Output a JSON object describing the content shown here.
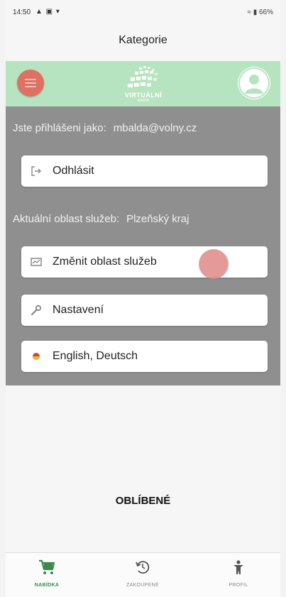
{
  "status_bar": {
    "time": "14:50",
    "icons": "▲ ▣ ▾",
    "right": "≈ ▮ 66%"
  },
  "page": {
    "title": "Kategorie"
  },
  "header": {
    "logo_text": "VIRTUÁLNÍ",
    "logo_sub": "KARTA",
    "accent_color": "#b7e4c0"
  },
  "menu": {
    "logged_in_label": "Jste přihlášeni jako:",
    "logged_in_value": "mbalda@volny.cz",
    "logout_label": "Odhlásit",
    "area_label": "Aktuální oblast služeb:",
    "area_value": "Plzeňský kraj",
    "change_area_label": "Změnit oblast služeb",
    "settings_label": "Nastavení",
    "language_label": "English, Deutsch"
  },
  "content": {
    "favorites_label": "OBLÍBENÉ"
  },
  "bottom_nav": {
    "items": [
      {
        "label": "NABÍDKA",
        "icon": "cart-icon",
        "active": true
      },
      {
        "label": "ZAKOUPENÉ",
        "icon": "history-icon",
        "active": false
      },
      {
        "label": "PROFIL",
        "icon": "person-icon",
        "active": false
      }
    ]
  }
}
